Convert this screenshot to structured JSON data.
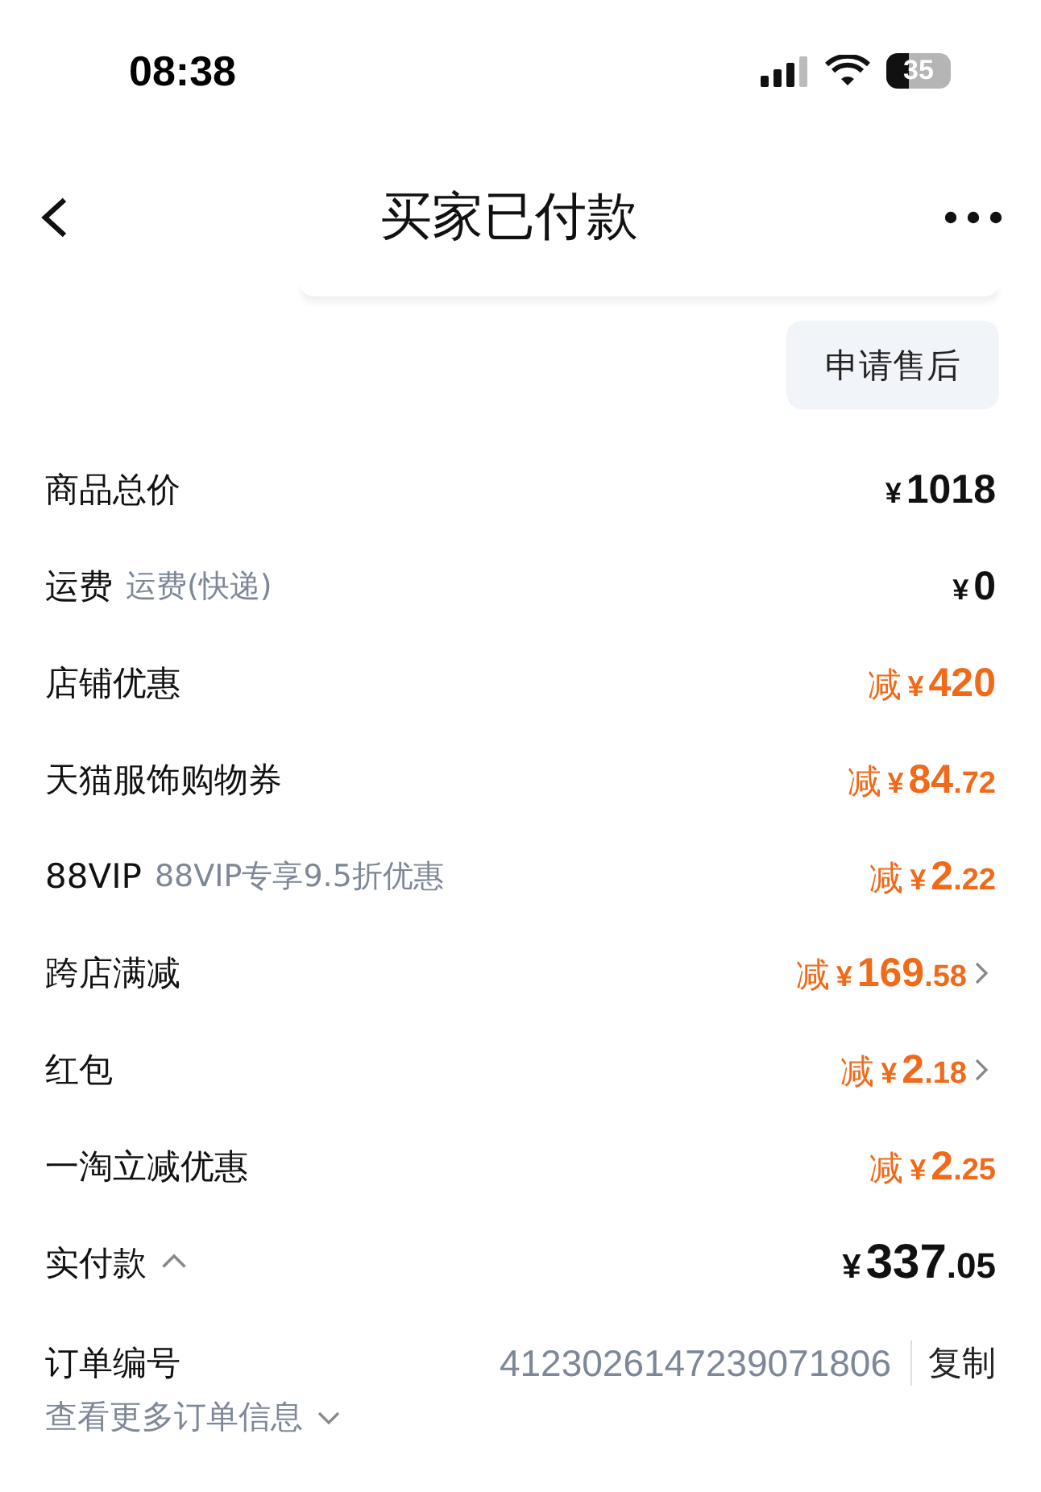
{
  "status_bar": {
    "time": "08:38",
    "battery": "35"
  },
  "nav": {
    "title": "买家已付款"
  },
  "actions": [
    "申请售后"
  ],
  "rows": [
    {
      "kind": "plain",
      "label": "商品总价",
      "currency": "¥",
      "whole": "1018",
      "link": false
    },
    {
      "kind": "plain",
      "label": "运费",
      "note": "运费(快递)",
      "currency": "¥",
      "whole": "0",
      "link": false
    },
    {
      "kind": "discount",
      "label": "店铺优惠",
      "prefix": "减",
      "currency": "¥",
      "whole": "420",
      "link": false
    },
    {
      "kind": "discount",
      "label": "天猫服饰购物券",
      "prefix": "减",
      "currency": "¥",
      "whole": "84",
      "cents": ".72",
      "link": false
    },
    {
      "kind": "discount",
      "label": "88VIP",
      "note": "88VIP专享9.5折优惠",
      "prefix": "减",
      "currency": "¥",
      "whole": "2",
      "cents": ".22",
      "link": false
    },
    {
      "kind": "discount",
      "label": "跨店满减",
      "prefix": "减",
      "currency": "¥",
      "whole": "169",
      "cents": ".58",
      "link": true
    },
    {
      "kind": "discount",
      "label": "红包",
      "prefix": "减",
      "currency": "¥",
      "whole": "2",
      "cents": ".18",
      "link": true
    },
    {
      "kind": "discount",
      "label": "一淘立减优惠",
      "prefix": "减",
      "currency": "¥",
      "whole": "2",
      "cents": ".25",
      "link": false
    },
    {
      "kind": "total",
      "label": "实付款",
      "expanded": true,
      "currency": "¥",
      "whole": "337",
      "cents": ".05",
      "link": false
    }
  ],
  "order": {
    "label": "订单编号",
    "number": "4123026147239071806",
    "copy": "复制",
    "more": "查看更多订单信息"
  }
}
